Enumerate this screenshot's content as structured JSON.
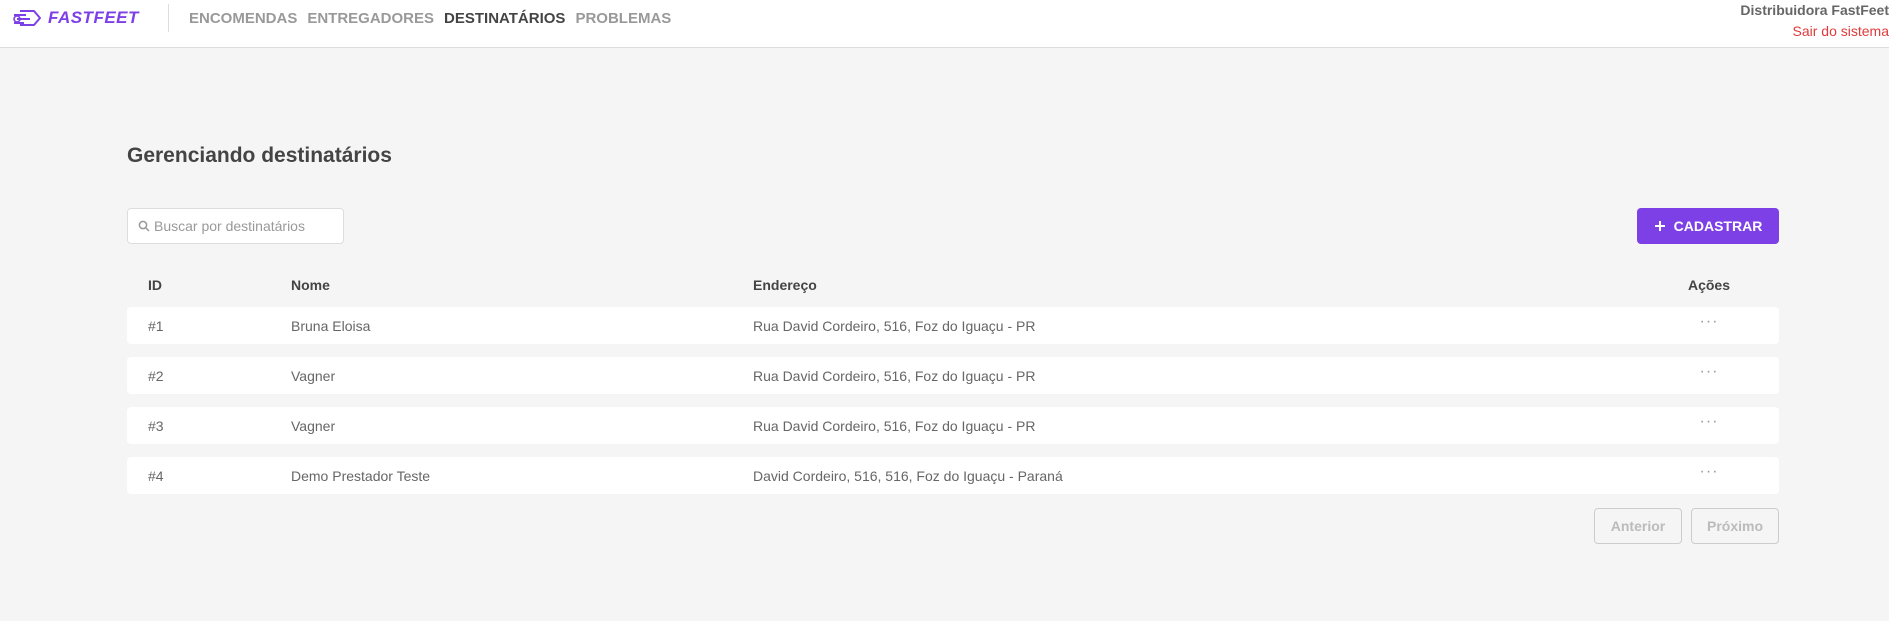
{
  "header": {
    "logo_text": "FASTFEET",
    "nav": [
      {
        "label": "ENCOMENDAS",
        "active": false
      },
      {
        "label": "ENTREGADORES",
        "active": false
      },
      {
        "label": "DESTINATÁRIOS",
        "active": true
      },
      {
        "label": "PROBLEMAS",
        "active": false
      }
    ],
    "company_name": "Distribuidora FastFeet",
    "logout_label": "Sair do sistema"
  },
  "page": {
    "title": "Gerenciando destinatários",
    "search": {
      "placeholder": "Buscar por destinatários",
      "value": ""
    },
    "add_button_label": "CADASTRAR"
  },
  "table": {
    "columns": [
      "ID",
      "Nome",
      "Endereço",
      "Ações"
    ],
    "rows": [
      {
        "id": "#1",
        "name": "Bruna Eloisa",
        "address": "Rua David Cordeiro, 516, Foz do Iguaçu - PR",
        "actions": "···"
      },
      {
        "id": "#2",
        "name": "Vagner",
        "address": "Rua David Cordeiro, 516, Foz do Iguaçu - PR",
        "actions": "···"
      },
      {
        "id": "#3",
        "name": "Vagner",
        "address": "Rua David Cordeiro, 516, Foz do Iguaçu - PR",
        "actions": "···"
      },
      {
        "id": "#4",
        "name": "Demo Prestador Teste",
        "address": "David Cordeiro, 516, 516, Foz do Iguaçu - Paraná",
        "actions": "···"
      }
    ]
  },
  "pagination": {
    "prev_label": "Anterior",
    "next_label": "Próximo"
  },
  "colors": {
    "brand": "#7d40e7",
    "logout": "#de3b3b",
    "background": "#f5f5f5"
  },
  "icons": {
    "logo": "delivery-truck-icon",
    "search": "search-icon",
    "add": "plus-icon",
    "actions": "more-horizontal-icon"
  }
}
